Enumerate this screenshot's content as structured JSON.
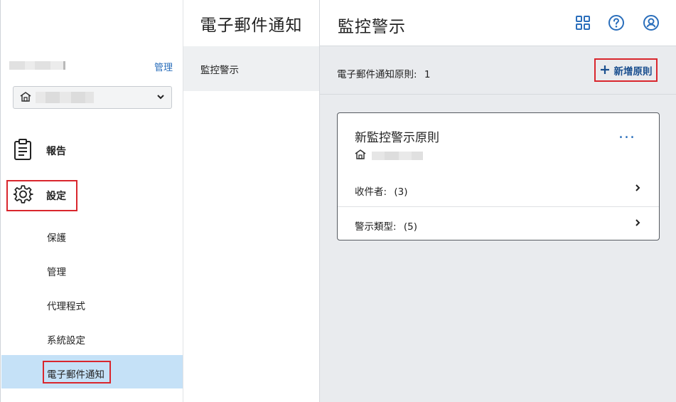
{
  "sidebar": {
    "manage_label": "管理",
    "nav_reports_label": "報告",
    "nav_settings_label": "設定",
    "sub_items": [
      "保護",
      "管理",
      "代理程式",
      "系統設定",
      "電子郵件通知"
    ]
  },
  "middle": {
    "title": "電子郵件通知",
    "item_label": "監控警示"
  },
  "main": {
    "title": "監控警示",
    "rule_count_label": "電子郵件通知原則:",
    "rule_count_value": "1",
    "add_rule_label": "新增原則",
    "card": {
      "title": "新監控警示原則",
      "more_label": "...",
      "recipients_label": "收件者:",
      "recipients_count": "(3)",
      "alert_types_label": "警示類型:",
      "alert_types_count": "(5)"
    }
  },
  "colors": {
    "accent": "#2a6ebb",
    "highlight_frame": "#d9262d",
    "selected_bg": "#c5e1f7"
  },
  "icons": [
    "apps-grid-icon",
    "help-icon",
    "user-account-icon",
    "building-icon",
    "clipboard-report-icon",
    "gear-icon",
    "chevron-down-icon",
    "chevron-right-icon",
    "plus-icon"
  ]
}
